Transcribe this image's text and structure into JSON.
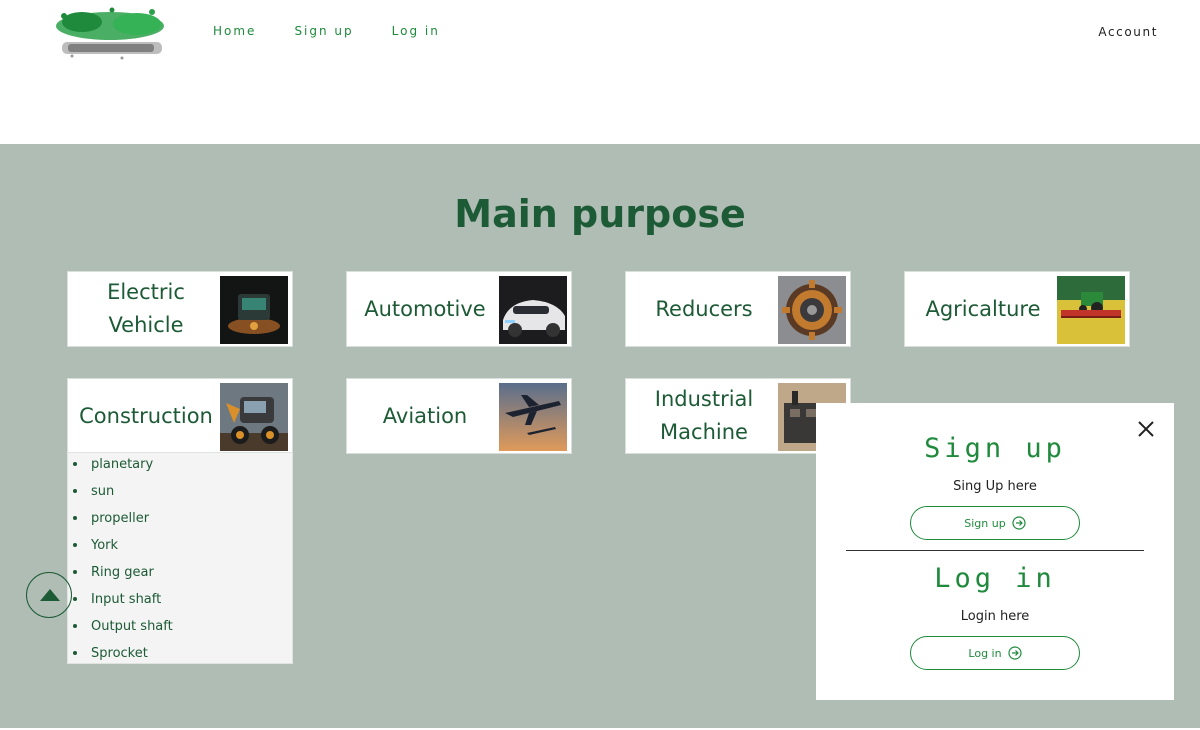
{
  "header": {
    "nav": [
      {
        "label": "Home"
      },
      {
        "label": "Sign up"
      },
      {
        "label": "Log in"
      }
    ],
    "account_label": "Account"
  },
  "main": {
    "title": "Main purpose",
    "cards": [
      {
        "label": "Electric Vehicle",
        "icon": "ev-charger-image"
      },
      {
        "label": "Automotive",
        "icon": "car-image"
      },
      {
        "label": "Reducers",
        "icon": "gear-reducer-image"
      },
      {
        "label": "Agricalture",
        "icon": "tractor-image"
      },
      {
        "label": "Construction",
        "icon": "excavator-image"
      },
      {
        "label": "Aviation",
        "icon": "airplane-image"
      },
      {
        "label": "Industrial Machine",
        "icon": "factory-image"
      }
    ],
    "dropdown_items": [
      "planetary",
      "sun",
      "propeller",
      "York",
      "Ring gear",
      "Input shaft",
      "Output shaft",
      "Sprocket"
    ]
  },
  "modal": {
    "signup_heading": "Sign up",
    "signup_text": "Sing Up here",
    "signup_button": "Sign up",
    "login_heading": "Log in",
    "login_text": "Login here",
    "login_button": "Log in"
  },
  "colors": {
    "accent": "#1f8a3c",
    "dark_green": "#1d5a36",
    "section_bg": "#afbdb4"
  }
}
